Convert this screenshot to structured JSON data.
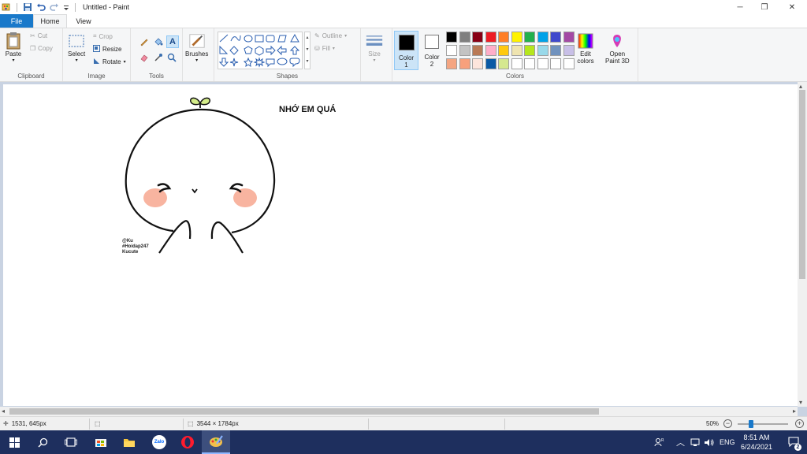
{
  "titlebar": {
    "title": "Untitled - Paint",
    "minimize": "─",
    "restore": "❐",
    "close": "✕",
    "collapse": "⌃",
    "help": "?"
  },
  "tabs": [
    {
      "label": "File"
    },
    {
      "label": "Home"
    },
    {
      "label": "View"
    }
  ],
  "ribbon": {
    "clipboard": {
      "label": "Clipboard",
      "paste": "Paste",
      "cut": "Cut",
      "copy": "Copy"
    },
    "image": {
      "label": "Image",
      "select": "Select",
      "crop": "Crop",
      "resize": "Resize",
      "rotate": "Rotate"
    },
    "tools": {
      "label": "Tools"
    },
    "brushes": {
      "label": "Brushes"
    },
    "shapes": {
      "label": "Shapes",
      "outline": "Outline",
      "fill": "Fill"
    },
    "size": {
      "label": "Size"
    },
    "colors": {
      "label": "Colors",
      "color1": "Color",
      "color1_num": "1",
      "color2": "Color",
      "color2_num": "2",
      "color1_value": "#000000",
      "color2_value": "#ffffff",
      "edit_colors_1": "Edit",
      "edit_colors_2": "colors",
      "paint3d_1": "Open",
      "paint3d_2": "Paint 3D",
      "palette_row1": [
        "#000000",
        "#7f7f7f",
        "#880015",
        "#ed1c24",
        "#ff7f27",
        "#fff200",
        "#22b14c",
        "#00a2e8",
        "#3f48cc",
        "#a349a4"
      ],
      "palette_row2": [
        "#ffffff",
        "#c3c3c3",
        "#b97a57",
        "#ffaec9",
        "#ffc90e",
        "#efe4b0",
        "#b5e61d",
        "#99d9ea",
        "#7092be",
        "#c8bfe7"
      ],
      "palette_row3": [
        "#f4a582",
        "#f7a07c",
        "#fde5dc",
        "#0b5aa5",
        "#d5e88f",
        "#ffffff",
        "#ffffff",
        "#ffffff",
        "#ffffff",
        "#ffffff"
      ]
    }
  },
  "canvas": {
    "text": "NHỚ EM QUÁ",
    "watermark": [
      "@Ku",
      "#Hoidap247",
      "Kucute"
    ]
  },
  "statusbar": {
    "cursor_pos": "1531, 645px",
    "image_size": "3544 × 1784px",
    "zoom": "50%",
    "zoom_fraction": 0.27
  },
  "taskbar": {
    "tray_lang": "ENG",
    "time": "8:51 AM",
    "date": "6/24/2021",
    "notifications": "2",
    "zalo_label": "Zalo"
  }
}
